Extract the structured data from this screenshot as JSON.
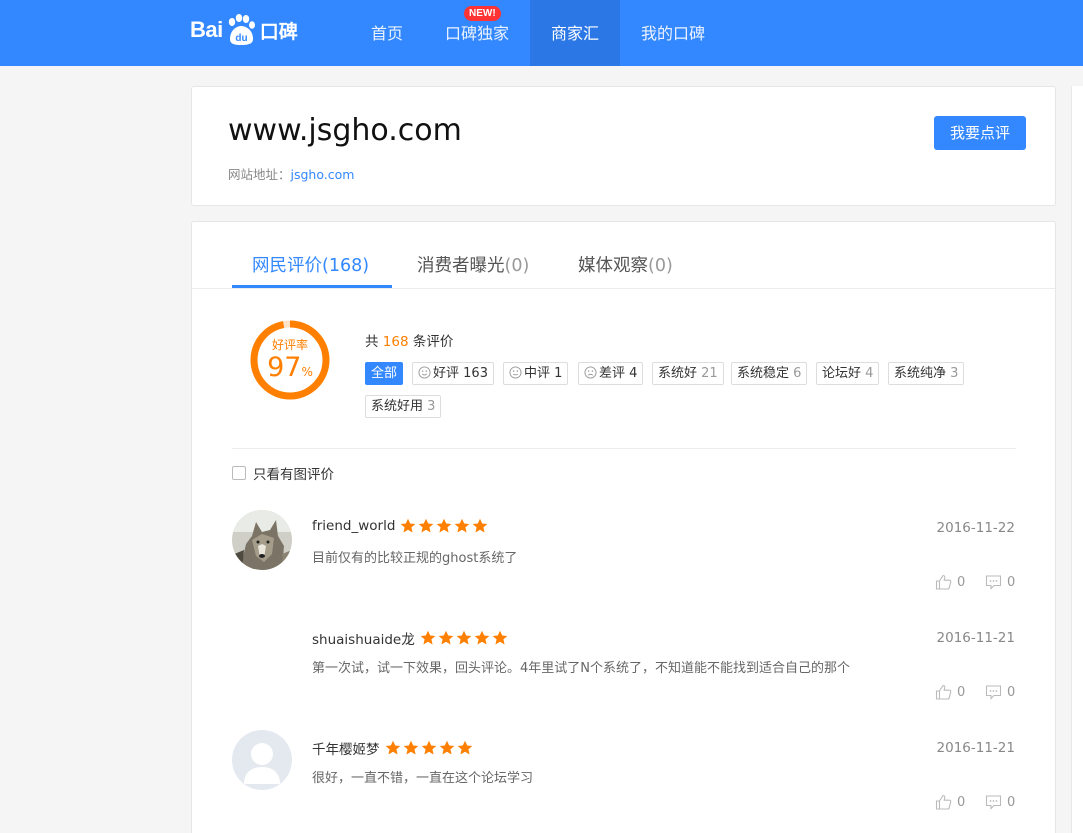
{
  "header": {
    "logo_bai": "Bai",
    "logo_du": "du",
    "logo_koubei": "口碑",
    "nav": [
      {
        "label": "首页"
      },
      {
        "label": "口碑独家",
        "badge": "NEW!"
      },
      {
        "label": "商家汇",
        "active": true
      },
      {
        "label": "我的口碑"
      }
    ]
  },
  "site": {
    "title": "www.jsgho.com",
    "url_label": "网站地址：",
    "url": "jsgho.com",
    "review_button": "我要点评"
  },
  "tabs": [
    {
      "label": "网民评价",
      "count": "(168)",
      "active": true
    },
    {
      "label": "消费者曝光",
      "count": "(0)"
    },
    {
      "label": "媒体观察",
      "count": "(0)"
    }
  ],
  "summary": {
    "rate_label": "好评率",
    "rate_value": "97",
    "rate_unit": "%",
    "rate_fraction": 0.97,
    "total_prefix": "共 ",
    "total_count": "168",
    "total_suffix": " 条评价"
  },
  "filters": [
    {
      "label": "全部",
      "count": "",
      "active": true
    },
    {
      "label": "好评",
      "count": "163",
      "icon": "smile-icon"
    },
    {
      "label": "中评",
      "count": "1",
      "icon": "neutral-face-icon"
    },
    {
      "label": "差评",
      "count": "4",
      "icon": "sad-face-icon"
    },
    {
      "label": "系统好",
      "count": "21"
    },
    {
      "label": "系统稳定",
      "count": "6"
    },
    {
      "label": "论坛好",
      "count": "4"
    },
    {
      "label": "系统纯净",
      "count": "3"
    },
    {
      "label": "系统好用",
      "count": "3"
    }
  ],
  "pic_only_label": "只看有图评价",
  "reviews": [
    {
      "user": "friend_world",
      "stars": 5,
      "date": "2016-11-22",
      "text": "目前仅有的比较正规的ghost系统了",
      "likes": "0",
      "comments": "0",
      "avatar": "wolf-avatar"
    },
    {
      "user": "shuaishuaide龙",
      "stars": 5,
      "date": "2016-11-21",
      "text": "第一次试，试一下效果，回头评论。4年里试了N个系统了，不知道能不能找到适合自己的那个",
      "likes": "0",
      "comments": "0",
      "avatar": "none"
    },
    {
      "user": "千年樱姬梦",
      "stars": 5,
      "date": "2016-11-21",
      "text": "很好，一直不错，一直在这个论坛学习",
      "likes": "0",
      "comments": "0",
      "avatar": "default-avatar"
    }
  ],
  "colors": {
    "brand_blue": "#3388ff",
    "accent_orange": "#ff7f00"
  }
}
